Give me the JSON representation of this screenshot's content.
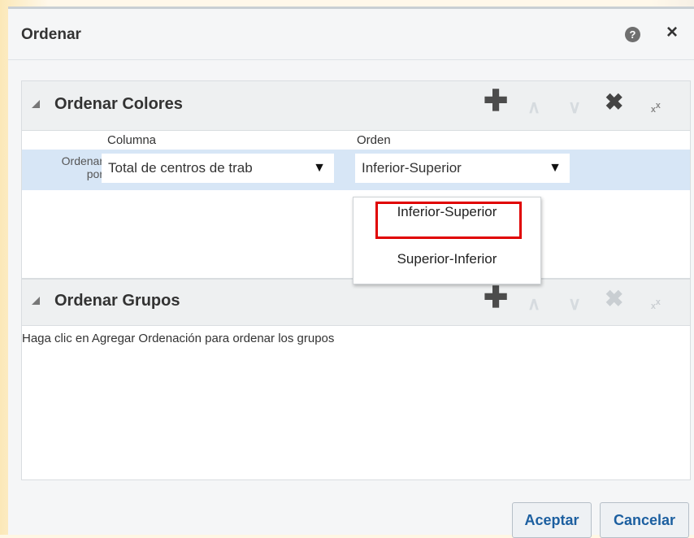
{
  "dialog": {
    "title": "Ordenar",
    "help_icon": "help-icon",
    "help_glyph": "?",
    "close_icon": "close-icon",
    "close_glyph": "×"
  },
  "colors_panel": {
    "title": "Ordenar Colores",
    "toolbar_glyphs": {
      "add": "✚",
      "up": "∧",
      "down": "∨",
      "delete": "✖",
      "delete_all": "ₓˣ"
    },
    "columns": {
      "column": "Columna",
      "order": "Orden"
    },
    "row": {
      "label": "Ordenar por",
      "column_value": "Total de centros de trab",
      "order_value": "Inferior-Superior",
      "arrow": "▼"
    }
  },
  "groups_panel": {
    "title": "Ordenar Grupos",
    "toolbar_glyphs": {
      "add": "✚",
      "up": "∧",
      "down": "∨",
      "delete": "✖",
      "delete_all": "ₓˣ"
    },
    "empty_message": "Haga clic en Agregar Ordenación para ordenar los grupos"
  },
  "order_dropdown": {
    "options": [
      "Inferior-Superior",
      "Superior-Inferior"
    ],
    "highlighted": "Inferior-Superior",
    "highlight_color": "#e00000"
  },
  "buttons": {
    "ok": "Aceptar",
    "cancel": "Cancelar"
  },
  "colors": {
    "selected_row": "#d7e6f6",
    "link_blue": "#1c5fa0",
    "panel_header": "#eef0f1"
  }
}
